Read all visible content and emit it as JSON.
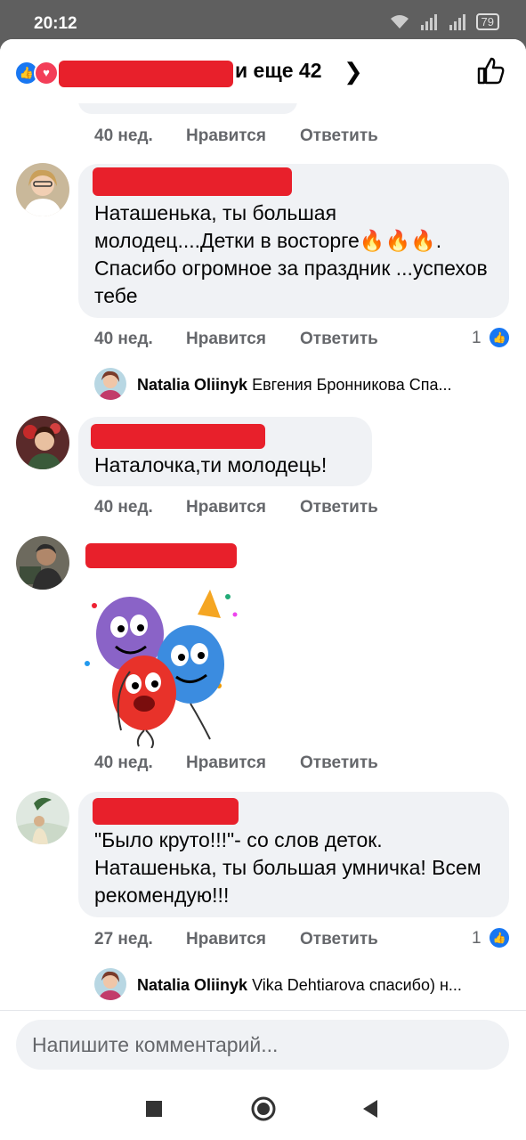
{
  "status_bar": {
    "time": "20:12",
    "battery": "79"
  },
  "header": {
    "others_text": "и еще 42"
  },
  "comments": [
    {
      "id": "c0",
      "time": "40 нед.",
      "like_label": "Нравится",
      "reply_label": "Ответить"
    },
    {
      "id": "c1",
      "text": "Наташенька, ты большая молодец....Детки в восторге🔥🔥🔥. Спасибо огромное за праздник ...успехов тебе",
      "time": "40 нед.",
      "like_label": "Нравится",
      "reply_label": "Ответить",
      "likes": "1",
      "reply_preview": {
        "author": "Natalia Oliinyk",
        "text": "Евгения Бронникова Спа..."
      }
    },
    {
      "id": "c2",
      "text": "Наталочка,ти молодець!",
      "time": "40 нед.",
      "like_label": "Нравится",
      "reply_label": "Ответить"
    },
    {
      "id": "c3",
      "sticker": "party-balloons-sticker",
      "time": "40 нед.",
      "like_label": "Нравится",
      "reply_label": "Ответить"
    },
    {
      "id": "c4",
      "text": "\"Было круто!!!\"- со слов деток. Наташенька, ты большая умничка! Всем рекомендую!!!",
      "time": "27 нед.",
      "like_label": "Нравится",
      "reply_label": "Ответить",
      "likes": "1",
      "reply_preview": {
        "author": "Natalia Oliinyk",
        "text": "Vika Dehtiarova спасибо) н..."
      }
    }
  ],
  "composer": {
    "placeholder": "Напишите комментарий..."
  },
  "colors": {
    "accent": "#1877f2",
    "heart": "#f33e58",
    "redaction": "#e8202b",
    "bubble": "#f0f2f5",
    "meta": "#65676b"
  }
}
